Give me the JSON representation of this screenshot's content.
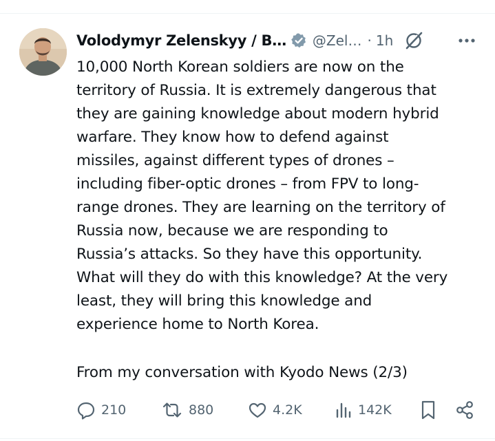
{
  "post": {
    "author_name": "Volodymyr Zelenskyy / B…",
    "handle": "@Zel…",
    "separator": "·",
    "time": "1h",
    "text": "10,000 North Korean soldiers are now on the\nterritory of Russia. It is extremely dangerous that\nthey are gaining knowledge about modern hybrid\nwarfare. They know how to defend against\nmissiles, against different types of drones –\nincluding fiber-optic drones – from FPV to long-\nrange drones. They are learning on the territory of\nRussia now, because we are responding to\nRussia’s attacks. So they have this opportunity.\nWhat will they do with this knowledge? At the very\nleast, they will bring this knowledge and\nexperience home to North Korea.",
    "source_line": "From my conversation with Kyodo News (2/3)"
  },
  "actions": {
    "replies": "210",
    "reposts": "880",
    "likes": "4.2K",
    "views": "142K"
  },
  "colors": {
    "text": "#0f1419",
    "secondary": "#536471",
    "verified_badge": "#829aab",
    "divider": "#eff3f4"
  },
  "icons": [
    "verified-badge-icon",
    "grok-icon",
    "more-icon",
    "reply-icon",
    "repost-icon",
    "like-icon",
    "views-icon",
    "bookmark-icon",
    "share-icon"
  ]
}
